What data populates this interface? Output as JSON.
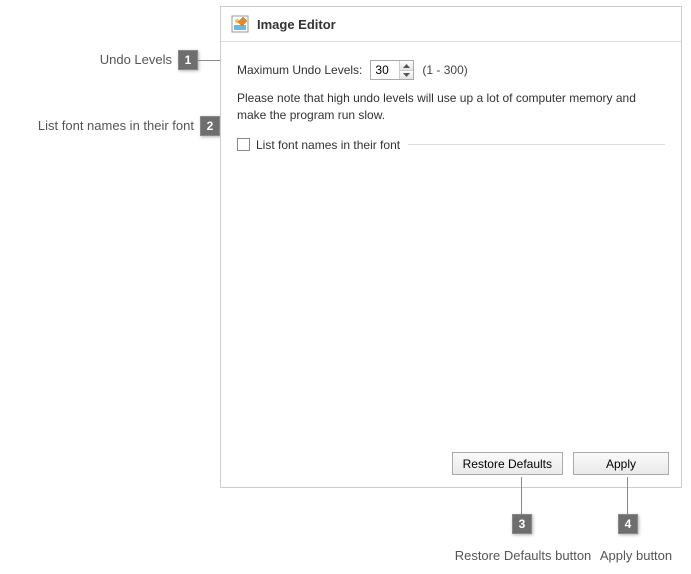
{
  "panel": {
    "title": "Image Editor",
    "undo_label": "Maximum Undo Levels:",
    "undo_value": "30",
    "undo_range": "(1 - 300)",
    "note": "Please note that high undo levels will use up a lot of computer memory and make the program run slow.",
    "checkbox_label": "List font names in their font",
    "restore_button": "Restore Defaults",
    "apply_button": "Apply"
  },
  "callouts": {
    "c1": {
      "num": "1",
      "label": "Undo Levels"
    },
    "c2": {
      "num": "2",
      "label": "List font names in their font"
    },
    "c3": {
      "num": "3",
      "label": "Restore Defaults button"
    },
    "c4": {
      "num": "4",
      "label": "Apply button"
    }
  }
}
